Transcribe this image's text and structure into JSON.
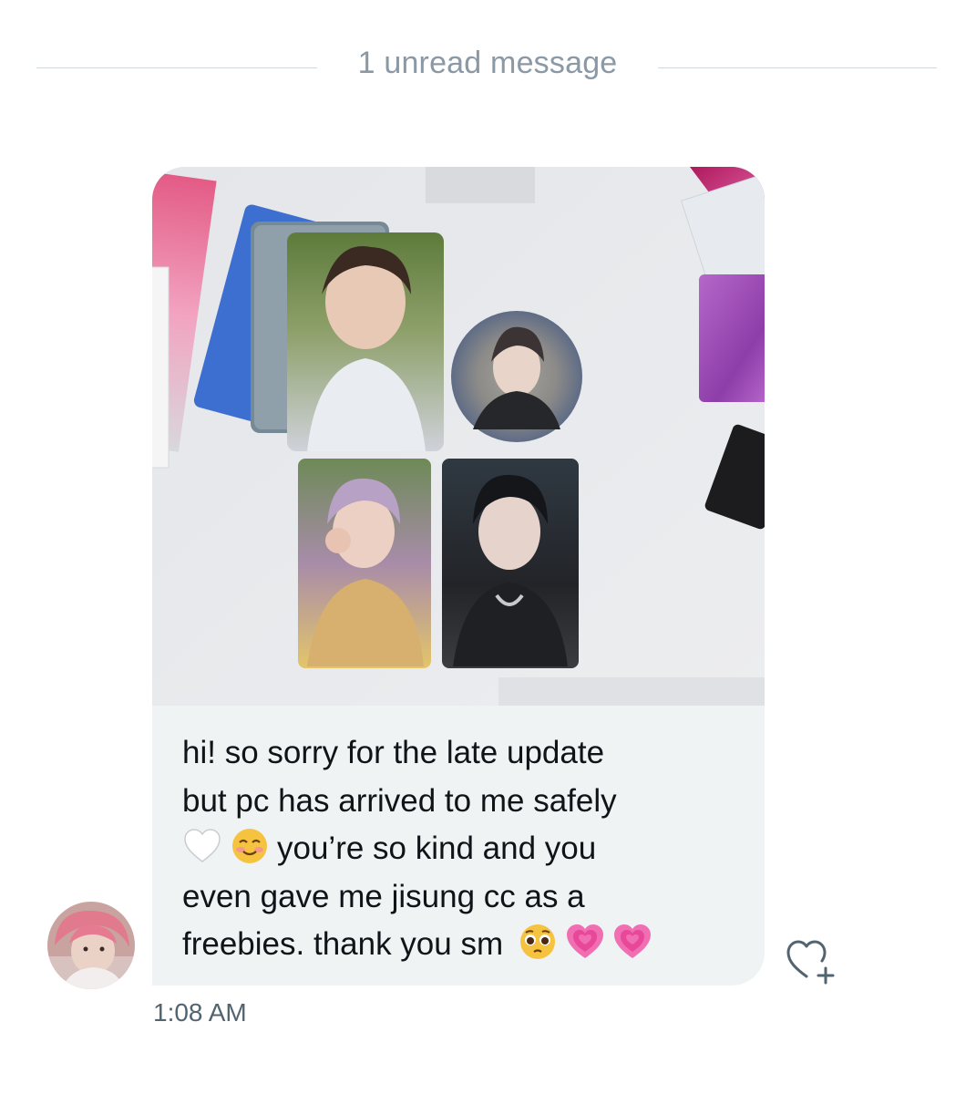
{
  "conversation": {
    "unread_divider": "1 unread message",
    "message": {
      "line_1": "hi! so sorry for the late update",
      "line_2": "but pc has arrived to me safely",
      "line_3_text": "you’re so kind and you",
      "line_4": "even gave me jisung cc as a",
      "line_5_text": "freebies. thank you sm",
      "emojis": [
        "white-heart-icon",
        "smiling-face-icon",
        "pleading-face-icon",
        "growing-heart-icon",
        "growing-heart-icon"
      ],
      "timestamp": "1:08 AM",
      "has_photo": true
    },
    "actions": {
      "react_icon": "heart-plus-icon"
    },
    "colors": {
      "bubble": "#eff3f4",
      "text": "#0f1419",
      "muted": "#536471",
      "divider": "#cfd9de",
      "accent_pink": "#e8479a"
    }
  }
}
